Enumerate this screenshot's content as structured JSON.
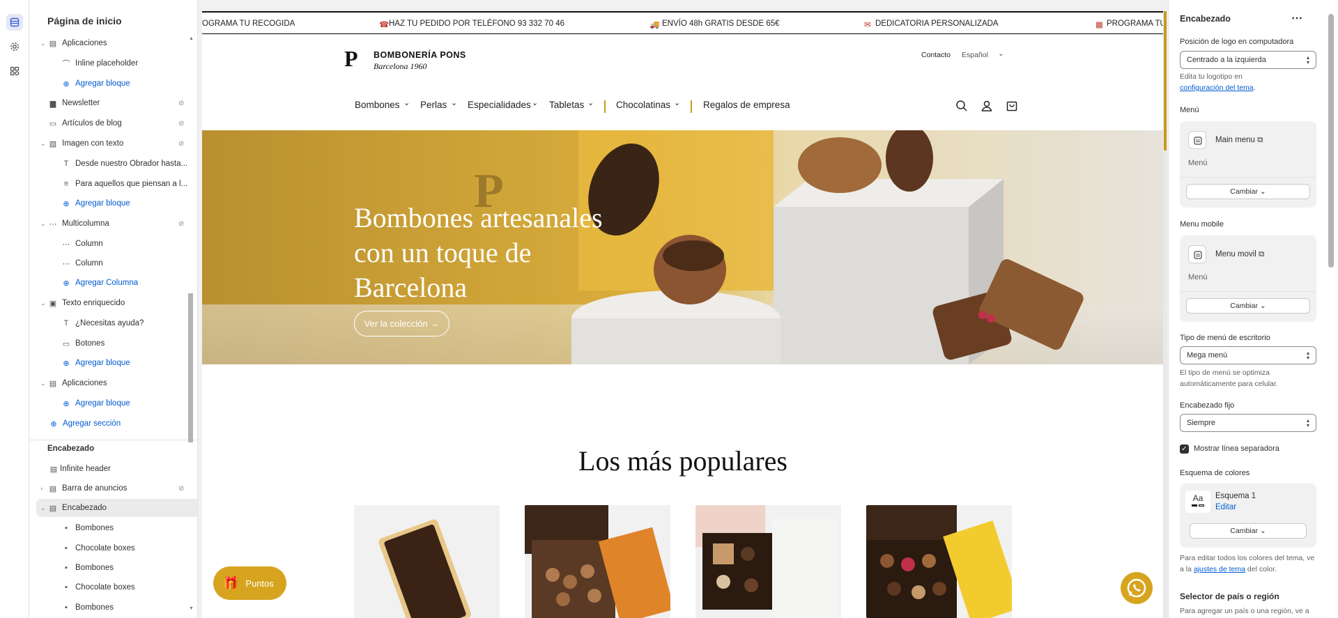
{
  "sidebar": {
    "title": "Página de inicio",
    "items": [
      {
        "label": "Aplicaciones",
        "icon": "apps-icon"
      },
      {
        "label": "Inline placeholder",
        "icon": "app-block-icon"
      },
      {
        "label": "Agregar bloque",
        "icon": "plus-circle-icon"
      },
      {
        "label": "Newsletter",
        "icon": "newsletter-icon"
      },
      {
        "label": "Artículos de blog",
        "icon": "blog-icon"
      },
      {
        "label": "Imagen con texto",
        "icon": "image-text-icon"
      },
      {
        "label": "Desde nuestro Obrador hasta...",
        "icon": "text-icon"
      },
      {
        "label": "Para aquellos que piensan a l...",
        "icon": "paragraph-icon"
      },
      {
        "label": "Agregar bloque",
        "icon": "plus-circle-icon"
      },
      {
        "label": "Multicolumna",
        "icon": "multicolumn-icon"
      },
      {
        "label": "Column",
        "icon": "column-icon"
      },
      {
        "label": "Column",
        "icon": "column-icon"
      },
      {
        "label": "Agregar Columna",
        "icon": "plus-circle-icon"
      },
      {
        "label": "Texto enriquecido",
        "icon": "rich-text-icon"
      },
      {
        "label": "¿Necesitas ayuda?",
        "icon": "text-icon"
      },
      {
        "label": "Botones",
        "icon": "buttons-icon"
      },
      {
        "label": "Agregar bloque",
        "icon": "plus-circle-icon"
      },
      {
        "label": "Aplicaciones",
        "icon": "apps-icon"
      },
      {
        "label": "Agregar bloque",
        "icon": "plus-circle-icon"
      },
      {
        "label": "Agregar sección",
        "icon": "plus-circle-icon"
      }
    ],
    "header_group": "Encabezado",
    "header_items": [
      {
        "label": "Infinite header",
        "icon": "header-icon"
      },
      {
        "label": "Barra de anuncios",
        "icon": "announcement-icon"
      },
      {
        "label": "Encabezado",
        "icon": "header-icon"
      },
      {
        "label": "Bombones",
        "icon": "menu-image-icon"
      },
      {
        "label": "Chocolate boxes",
        "icon": "menu-image-icon"
      },
      {
        "label": "Bombones",
        "icon": "menu-image-icon"
      },
      {
        "label": "Chocolate boxes",
        "icon": "menu-image-icon"
      },
      {
        "label": "Bombones",
        "icon": "menu-image-icon"
      }
    ]
  },
  "announcement": {
    "items": [
      "OGRAMA TU RECOGIDA",
      "HAZ TU PEDIDO POR TELÉFONO 93 332 70 46",
      "ENVÍO 48h GRATIS DESDE 65€",
      "DEDICATORIA PERSONALIZADA",
      "PROGRAMA TU"
    ]
  },
  "store_header": {
    "brand": "BOMBONERÍA PONS",
    "tagline": "Barcelona 1960",
    "contact": "Contacto",
    "language": "Español",
    "nav": [
      "Bombones",
      "Perlas",
      "Especialidades",
      "Tabletas",
      "Chocolatinas",
      "Regalos de empresa"
    ]
  },
  "hero": {
    "title_line1": "Bombones artesanales",
    "title_line2": "con un toque de",
    "title_line3": "Barcelona",
    "button": "Ver la colección →"
  },
  "popular": {
    "title": "Los más populares"
  },
  "loyalty": {
    "label": "Puntos"
  },
  "panel": {
    "title": "Encabezado",
    "logo_position_label": "Posición de logo en computadora",
    "logo_position_value": "Centrado a la izquierda",
    "logo_help_1": "Edita tu logotipo en",
    "logo_help_link": "configuración del tema",
    "menu_label": "Menú",
    "menu_name": "Main menu",
    "menu_sub": "Menú",
    "change": "Cambiar",
    "mobile_menu_label": "Menu mobile",
    "mobile_menu_name": "Menu movil",
    "mobile_menu_sub": "Menú",
    "desktop_menu_type_label": "Tipo de menú de escritorio",
    "desktop_menu_type_value": "Mega menú",
    "desktop_menu_help": "El tipo de menú se optimiza automáticamente para celular.",
    "sticky_label": "Encabezado fijo",
    "sticky_value": "Siempre",
    "separator_label": "Mostrar línea separadora",
    "colors_label": "Esquema de colores",
    "scheme_name": "Esquema 1",
    "scheme_edit": "Editar",
    "scheme_sample": "Aa",
    "colors_help_1": "Para editar todos los colores del tema, ve a la",
    "colors_help_link": "ajustes de tema",
    "colors_help_2": "del color.",
    "country_label": "Selector de país o región",
    "country_help": "Para agregar un país o una región, ve a"
  },
  "colors": {
    "accent": "#d6a41f",
    "link": "#005bd3"
  }
}
